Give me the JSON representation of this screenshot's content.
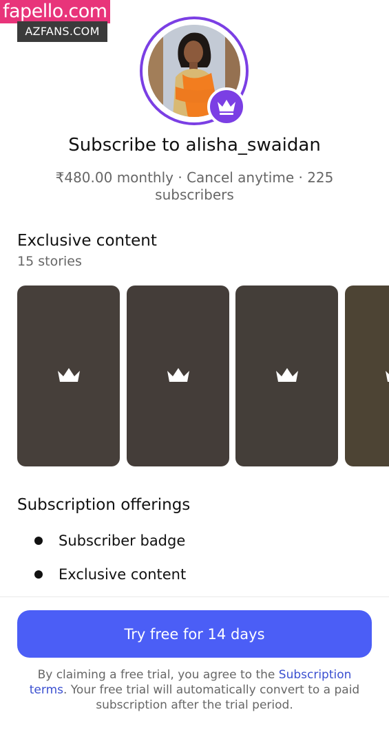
{
  "watermark": {
    "site": "fapello.com",
    "tag": "AZFANS.COM"
  },
  "header": {
    "title": "Subscribe to alisha_swaidan",
    "subtitle": "₹480.00 monthly · Cancel anytime · 225 subscribers"
  },
  "exclusive": {
    "heading": "Exclusive content",
    "count": "15 stories",
    "tiles": [
      {
        "color": "#463f3a",
        "icon": "crown-icon"
      },
      {
        "color": "#443d39",
        "icon": "crown-icon"
      },
      {
        "color": "#443e39",
        "icon": "crown-icon"
      },
      {
        "color": "#4d4434",
        "icon": "crown-icon"
      }
    ]
  },
  "offerings": {
    "heading": "Subscription offerings",
    "items": [
      "Subscriber badge",
      "Exclusive content"
    ]
  },
  "cta": {
    "label": "Try free for 14 days",
    "color": "#4b5ef6"
  },
  "legal": {
    "before": "By claiming a free trial, you agree to the ",
    "link": "Subscription terms",
    "after": ". Your free trial will automatically convert to a paid subscription after the trial period."
  },
  "accent": "#7b3fe4"
}
